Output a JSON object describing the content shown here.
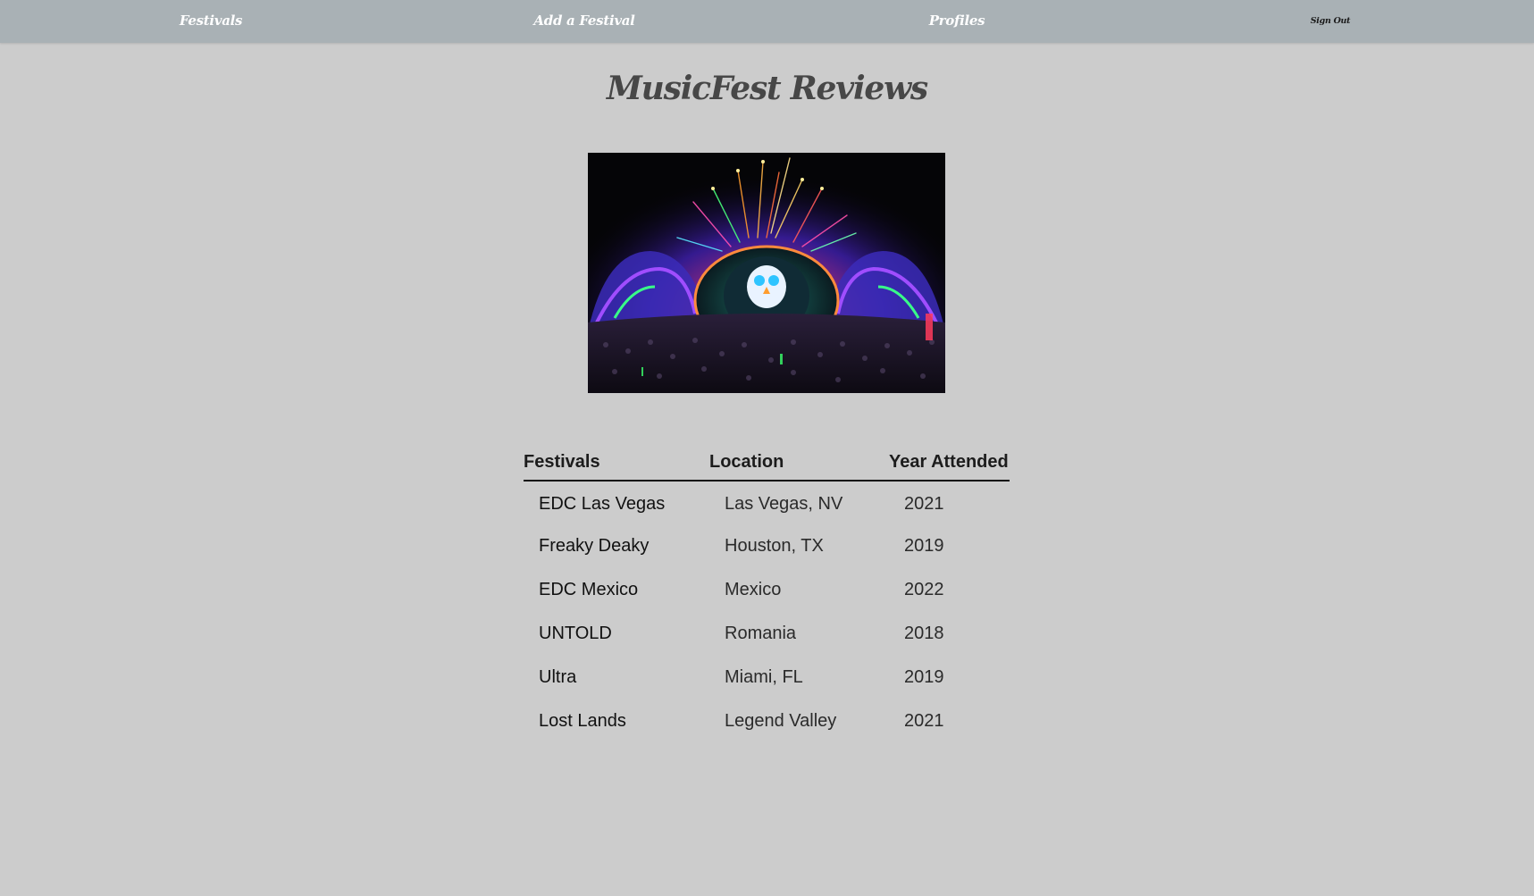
{
  "nav": {
    "festivals": "Festivals",
    "add_festival": "Add a Festival",
    "profiles": "Profiles",
    "sign_out": "Sign Out"
  },
  "page": {
    "title": "MusicFest Reviews"
  },
  "table": {
    "headers": [
      "Festivals",
      "Location",
      "Year Attended"
    ],
    "rows": [
      {
        "festival": "EDC Las Vegas",
        "location": "Las Vegas, NV",
        "year": "2021"
      },
      {
        "festival": "Freaky Deaky",
        "location": "Houston, TX",
        "year": "2019"
      },
      {
        "festival": "EDC Mexico",
        "location": "Mexico",
        "year": "2022"
      },
      {
        "festival": "UNTOLD",
        "location": "Romania",
        "year": "2018"
      },
      {
        "festival": "Ultra",
        "location": "Miami, FL",
        "year": "2019"
      },
      {
        "festival": "Lost Lands",
        "location": "Legend Valley",
        "year": "2021"
      }
    ]
  },
  "colors": {
    "navbar": "#a9b1b5",
    "background": "#cccccc",
    "title": "#474747"
  }
}
